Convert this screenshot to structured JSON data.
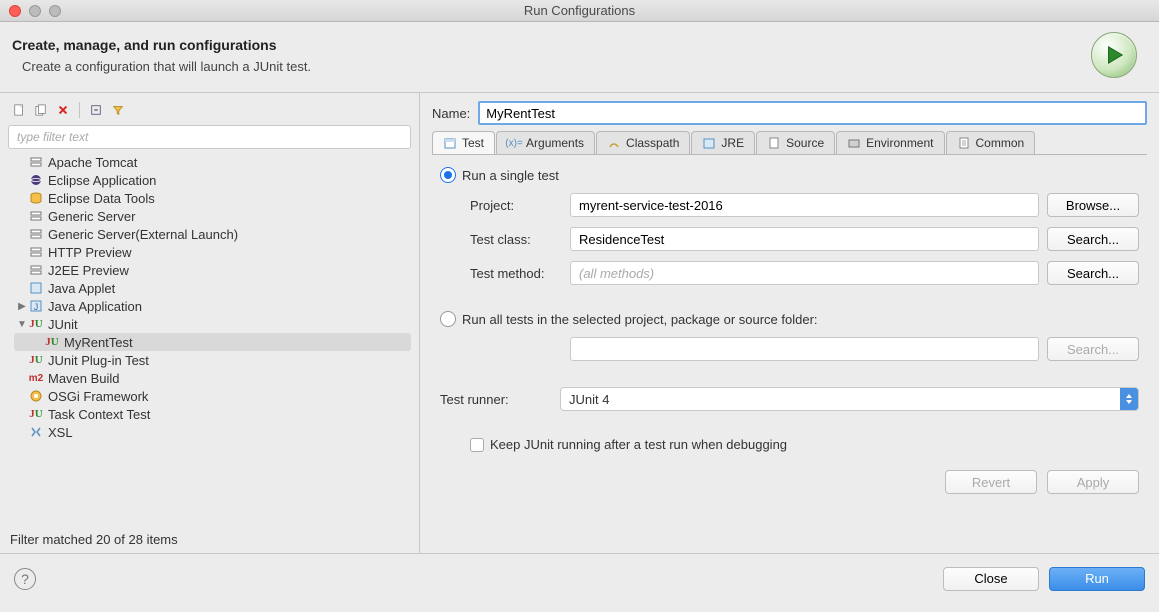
{
  "window": {
    "title": "Run Configurations"
  },
  "header": {
    "title": "Create, manage, and run configurations",
    "subtitle": "Create a configuration that will launch a JUnit test."
  },
  "left": {
    "filter_placeholder": "type filter text",
    "tree": [
      {
        "label": "Apache Tomcat",
        "depth": 0,
        "selected": false,
        "icon": "server"
      },
      {
        "label": "Eclipse Application",
        "depth": 0,
        "selected": false,
        "icon": "eclipse"
      },
      {
        "label": "Eclipse Data Tools",
        "depth": 0,
        "selected": false,
        "icon": "db"
      },
      {
        "label": "Generic Server",
        "depth": 0,
        "selected": false,
        "icon": "server"
      },
      {
        "label": "Generic Server(External Launch)",
        "depth": 0,
        "selected": false,
        "icon": "server"
      },
      {
        "label": "HTTP Preview",
        "depth": 0,
        "selected": false,
        "icon": "server"
      },
      {
        "label": "J2EE Preview",
        "depth": 0,
        "selected": false,
        "icon": "server"
      },
      {
        "label": "Java Applet",
        "depth": 0,
        "selected": false,
        "icon": "applet"
      },
      {
        "label": "Java Application",
        "depth": 0,
        "selected": false,
        "icon": "java",
        "arrow": "right"
      },
      {
        "label": "JUnit",
        "depth": 0,
        "selected": false,
        "icon": "junit",
        "arrow": "down"
      },
      {
        "label": "MyRentTest",
        "depth": 1,
        "selected": true,
        "icon": "junit"
      },
      {
        "label": "JUnit Plug-in Test",
        "depth": 0,
        "selected": false,
        "icon": "junit-plugin"
      },
      {
        "label": "Maven Build",
        "depth": 0,
        "selected": false,
        "icon": "maven"
      },
      {
        "label": "OSGi Framework",
        "depth": 0,
        "selected": false,
        "icon": "osgi"
      },
      {
        "label": "Task Context Test",
        "depth": 0,
        "selected": false,
        "icon": "junit-plugin"
      },
      {
        "label": "XSL",
        "depth": 0,
        "selected": false,
        "icon": "xsl"
      }
    ],
    "filter_status": "Filter matched 20 of 28 items"
  },
  "right": {
    "name_label": "Name:",
    "name_value": "MyRentTest",
    "tabs": [
      "Test",
      "Arguments",
      "Classpath",
      "JRE",
      "Source",
      "Environment",
      "Common"
    ],
    "active_tab": 0,
    "radio_single": "Run a single test",
    "radio_all": "Run all tests in the selected project, package or source folder:",
    "project_label": "Project:",
    "project_value": "myrent-service-test-2016",
    "browse_label": "Browse...",
    "testclass_label": "Test class:",
    "testclass_value": "ResidenceTest",
    "search_label": "Search...",
    "testmethod_label": "Test method:",
    "testmethod_placeholder": "(all methods)",
    "runner_label": "Test runner:",
    "runner_value": "JUnit 4",
    "keep_running_label": "Keep JUnit running after a test run when debugging",
    "revert_label": "Revert",
    "apply_label": "Apply"
  },
  "footer": {
    "close_label": "Close",
    "run_label": "Run"
  }
}
